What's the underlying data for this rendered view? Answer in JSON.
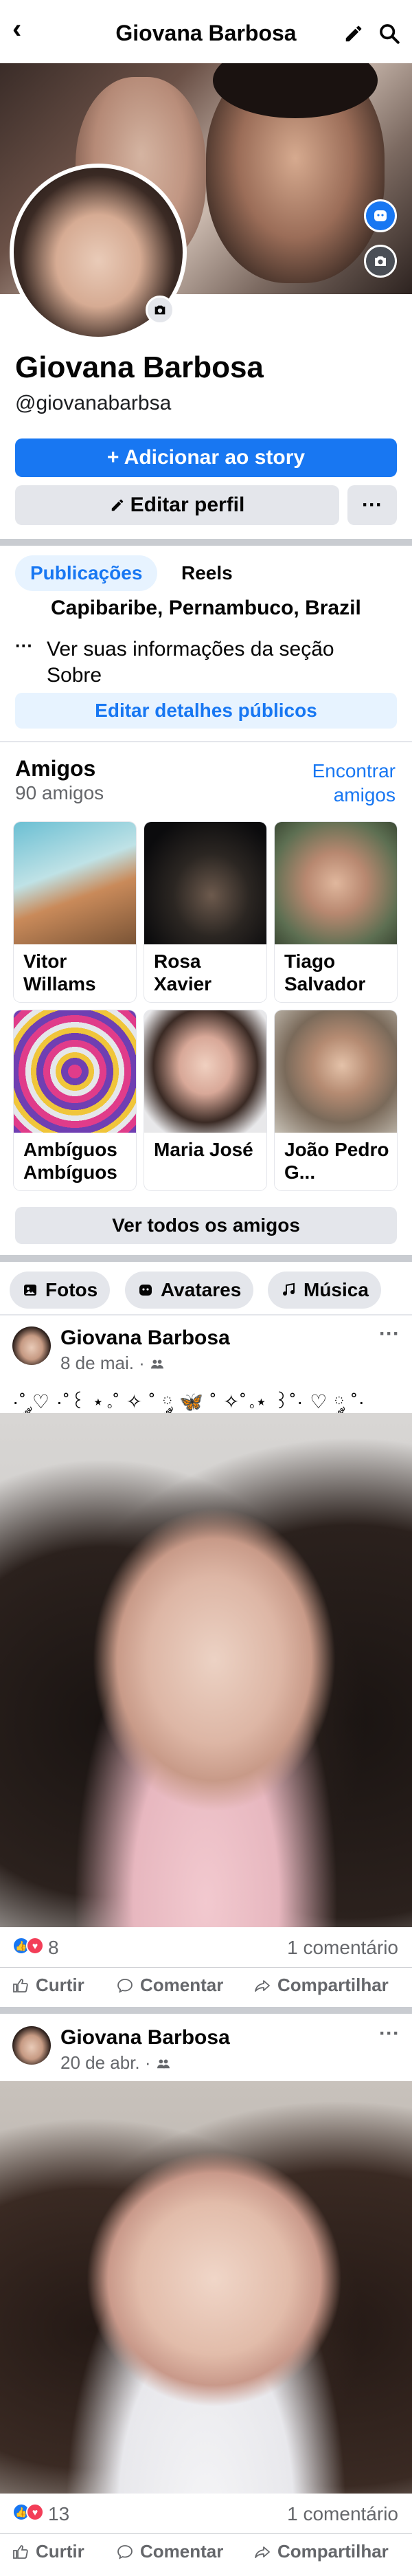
{
  "header": {
    "title": "Giovana Barbosa"
  },
  "profile": {
    "name": "Giovana Barbosa",
    "handle": "@giovanabarbsa",
    "add_story": "+ Adicionar ao story",
    "edit_profile": "Editar perfil",
    "more": "···"
  },
  "tabs": [
    {
      "label": "Publicações"
    },
    {
      "label": "Reels"
    }
  ],
  "details": {
    "location": "Capibaribe, Pernambuco, Brazil",
    "more_icon": "···",
    "more_text": "Ver suas informações da seção Sobre",
    "edit_public": "Editar detalhes públicos"
  },
  "friends": {
    "title": "Amigos",
    "count": "90 amigos",
    "find": "Encontrar amigos",
    "see_all": "Ver todos os amigos",
    "list": [
      {
        "name": "Vitor Willams"
      },
      {
        "name": "Rosa Xavier"
      },
      {
        "name": "Tiago Salvador"
      },
      {
        "name": "Ambíguos Ambíguos"
      },
      {
        "name": "Maria José"
      },
      {
        "name": "João Pedro G..."
      }
    ]
  },
  "chips": [
    {
      "label": "Fotos"
    },
    {
      "label": "Avatares"
    },
    {
      "label": "Música"
    }
  ],
  "posts": [
    {
      "author": "Giovana Barbosa",
      "date": "8 de mai. · ",
      "caption": "·˚ ༘♡ ·˚꒰ ⋆｡˚ ✧ ˚ ༘ 🦋 ˚ ✧˚｡⋆ ꒱˚· ♡ ༘ ˚·",
      "reactions": "8",
      "comments": "1 comentário"
    },
    {
      "author": "Giovana Barbosa",
      "date": "20 de abr. · ",
      "reactions": "13",
      "comments": "1 comentário"
    }
  ],
  "actions": {
    "like": "Curtir",
    "comment": "Comentar",
    "share": "Compartilhar"
  },
  "colors": {
    "accent": "#1877f2",
    "secondary_bg": "#e4e6eb",
    "accent_light": "#e7f3ff",
    "love": "#f33e58"
  }
}
